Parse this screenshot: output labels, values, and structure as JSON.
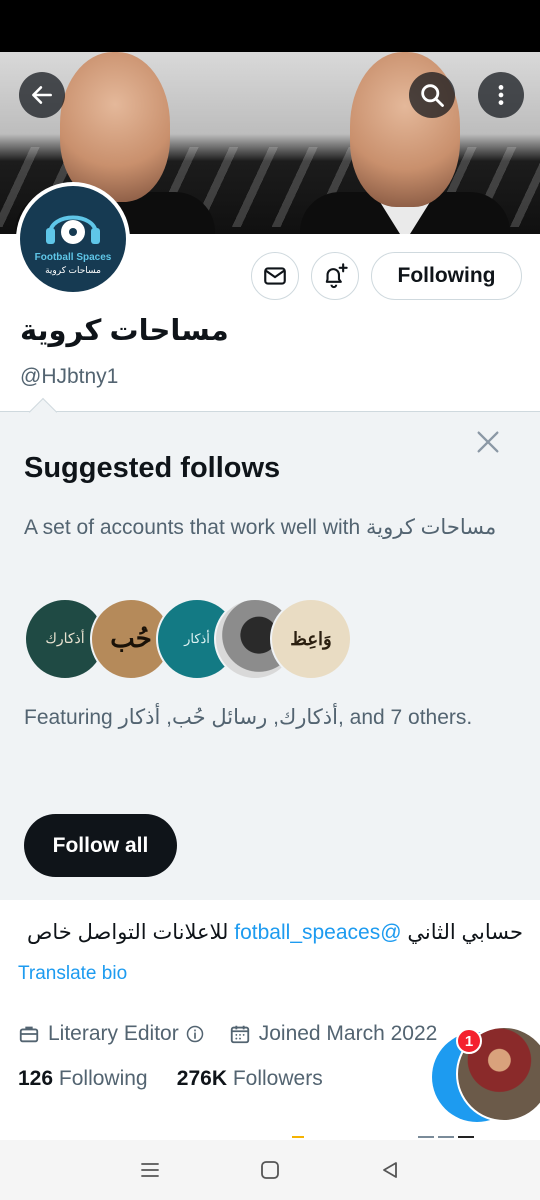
{
  "colors": {
    "accent": "#1d9bf0",
    "text_primary": "#0f1419",
    "text_secondary": "#536471",
    "panel_bg": "#f0f3f5",
    "badge_red": "#f4212e"
  },
  "header": {
    "back_icon": "arrow-left-icon",
    "search_icon": "search-icon",
    "more_icon": "more-vertical-icon"
  },
  "avatar": {
    "brand_line1": "Football Spaces",
    "brand_line2": "مساحات كروية"
  },
  "actions": {
    "message_icon": "envelope-icon",
    "notify_icon": "bell-plus-icon",
    "following_label": "Following"
  },
  "profile": {
    "name": "مساحات كروية",
    "handle": "@HJbtny1"
  },
  "suggested": {
    "title": "Suggested follows",
    "description": "A set of accounts that work well with مساحات كروية",
    "faces": [
      {
        "label": "أذكارك",
        "bg": "#1f4a44"
      },
      {
        "label": "حُب",
        "bg": "#b58a5a"
      },
      {
        "label": "أذكار",
        "bg": "#137a84"
      },
      {
        "label": "",
        "bg": "#4a4a4a"
      },
      {
        "label": "وَاعِظ",
        "bg": "#e9dcc3"
      }
    ],
    "featuring": "Featuring أذكارك, رسائل حُب, أذكار, and 7 others.",
    "follow_all_label": "Follow all"
  },
  "bio": {
    "text_before": "حسابي الثاني ",
    "mention": "@fotball_speaces",
    "text_after": " للاعلانات التواصل خاص",
    "translate_label": "Translate bio"
  },
  "meta": {
    "category": "Literary Editor",
    "joined": "Joined March 2022"
  },
  "counts": {
    "following_value": "126",
    "following_label": "Following",
    "followers_value": "276K",
    "followers_label": "Followers"
  },
  "fab": {
    "badge_count": "1"
  }
}
